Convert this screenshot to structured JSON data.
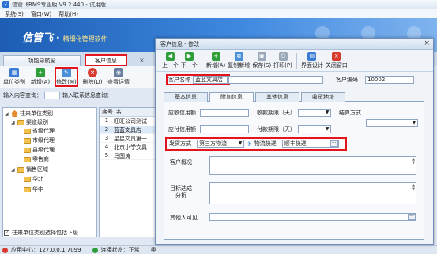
{
  "app": {
    "title": "信管飞RMS专业版 V9.2.440 - 试用版",
    "icon": "app-logo-icon"
  },
  "menu": [
    "系统(S)",
    "窗口(W)",
    "帮助(H)"
  ],
  "banner": {
    "brand_mark": "信管飞",
    "dot": "·",
    "slogan": "精细化管理软件"
  },
  "main_tabs": {
    "nav_tab": "功能导航窗",
    "customer_tab": "客户信息",
    "close": "×"
  },
  "main_toolbar": [
    {
      "label": "单位类别",
      "icon": "category-icon",
      "color": "#3a7bd5"
    },
    {
      "label": "新增(A)",
      "icon": "add-icon",
      "color": "#2e9e3a"
    },
    {
      "label": "修改(M)",
      "icon": "edit-icon",
      "color": "#4a8fd8"
    },
    {
      "label": "删除(D)",
      "icon": "delete-icon",
      "color": "#d83a2e"
    },
    {
      "label": "查看详情",
      "icon": "view-icon",
      "color": "#6a7fa0"
    }
  ],
  "search": {
    "content_label": "输入内容查询：",
    "contact_label": "输入联系信息查询："
  },
  "tree": {
    "root": "往来单位类别",
    "channel_group": "渠道级别",
    "channel_items": [
      "省级代理",
      "市级代理",
      "县级代理",
      "零售商"
    ],
    "region_group": "销售区域",
    "region_items": [
      "华北",
      "华中"
    ]
  },
  "include_sub": {
    "label": "往来单位类别选择包括下级",
    "checked": "✓"
  },
  "grid": {
    "columns": [
      "序号",
      "名"
    ],
    "rows": [
      {
        "no": "1",
        "name": "旺旺公司测试"
      },
      {
        "no": "2",
        "name": "蓝蓝文具店"
      },
      {
        "no": "3",
        "name": "星星文具第一"
      },
      {
        "no": "4",
        "name": "北京小学文具"
      },
      {
        "no": "5",
        "name": "马国涛"
      }
    ]
  },
  "status": {
    "app_center": "应用中心：127.0.0.1:7099",
    "connection": "连接状态：正常",
    "extra": "奥"
  },
  "dialog": {
    "title": "客户信息 - 修改",
    "close": "×",
    "toolbar": [
      {
        "label": "上一个",
        "icon": "prev-icon",
        "color": "#2e9e3a"
      },
      {
        "label": "下一个",
        "icon": "next-icon",
        "color": "#2e9e3a"
      },
      {
        "label": "新增(A)",
        "icon": "add-icon",
        "color": "#2e9e3a"
      },
      {
        "label": "复制新增",
        "icon": "copy-add-icon",
        "color": "#4a8fd8"
      },
      {
        "label": "保存(S)",
        "icon": "save-icon",
        "color": "#9aa7b8"
      },
      {
        "label": "打印(P)",
        "icon": "print-icon",
        "color": "#9aa7b8"
      },
      {
        "label": "界面设计",
        "icon": "layout-icon",
        "color": "#3a7bd5"
      },
      {
        "label": "关闭窗口",
        "icon": "close-window-icon",
        "color": "#d83a2e"
      }
    ],
    "customer_name_label": "客户名称",
    "customer_name_value": "蓝蓝文具店",
    "customer_code_label": "客户编码",
    "customer_code_value": "10002",
    "subtabs": [
      "基本信息",
      "附加信息",
      "其他信息",
      "收货地址"
    ],
    "receivable_label": "应收信用额",
    "collect_period_label": "收款期限（天）",
    "settle_label": "结算方式",
    "payable_label": "应付信用额",
    "pay_period_label": "付款期限（天）",
    "ship_label": "发货方式",
    "ship_value": "第三方物流",
    "logistics_label": "物流快递",
    "logistics_value": "顺丰快递",
    "ellipsis": "···",
    "overview_label": "客户概况",
    "target_label_1": "目标达成",
    "target_label_2": "分析",
    "others_label": "其他人可见"
  }
}
